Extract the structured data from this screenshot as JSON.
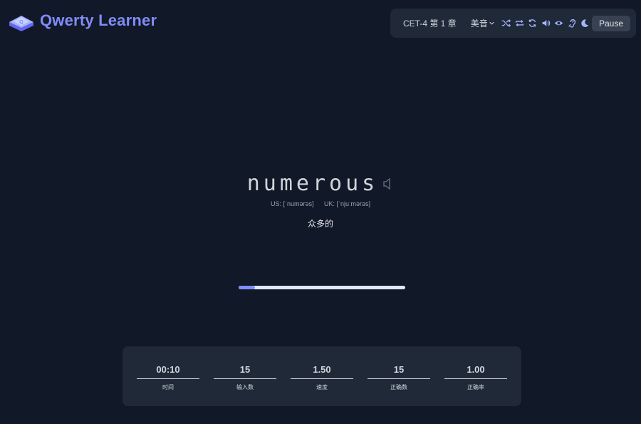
{
  "app": {
    "title": "Qwerty Learner"
  },
  "toolbar": {
    "dict_chapter": "CET-4 第 1 章",
    "accent": "美音",
    "icons": [
      "shuffle-icon",
      "loop-icon",
      "refresh-icon",
      "volume-icon",
      "eye-icon",
      "ear-icon",
      "moon-icon"
    ],
    "pause_label": "Pause"
  },
  "word": {
    "text": "numerous",
    "us": "US: [ˈnumərəs]",
    "uk": "UK: [ˈnjuːmərəs]",
    "translation": "众多的"
  },
  "progress": {
    "fraction": 0.1
  },
  "stats": [
    {
      "value": "00:10",
      "label": "时间"
    },
    {
      "value": "15",
      "label": "输入数"
    },
    {
      "value": "1.50",
      "label": "速度"
    },
    {
      "value": "15",
      "label": "正确数"
    },
    {
      "value": "1.00",
      "label": "正确率"
    }
  ],
  "colors": {
    "accent": "#818cf8",
    "background": "#111827",
    "panel": "#1f2937"
  }
}
